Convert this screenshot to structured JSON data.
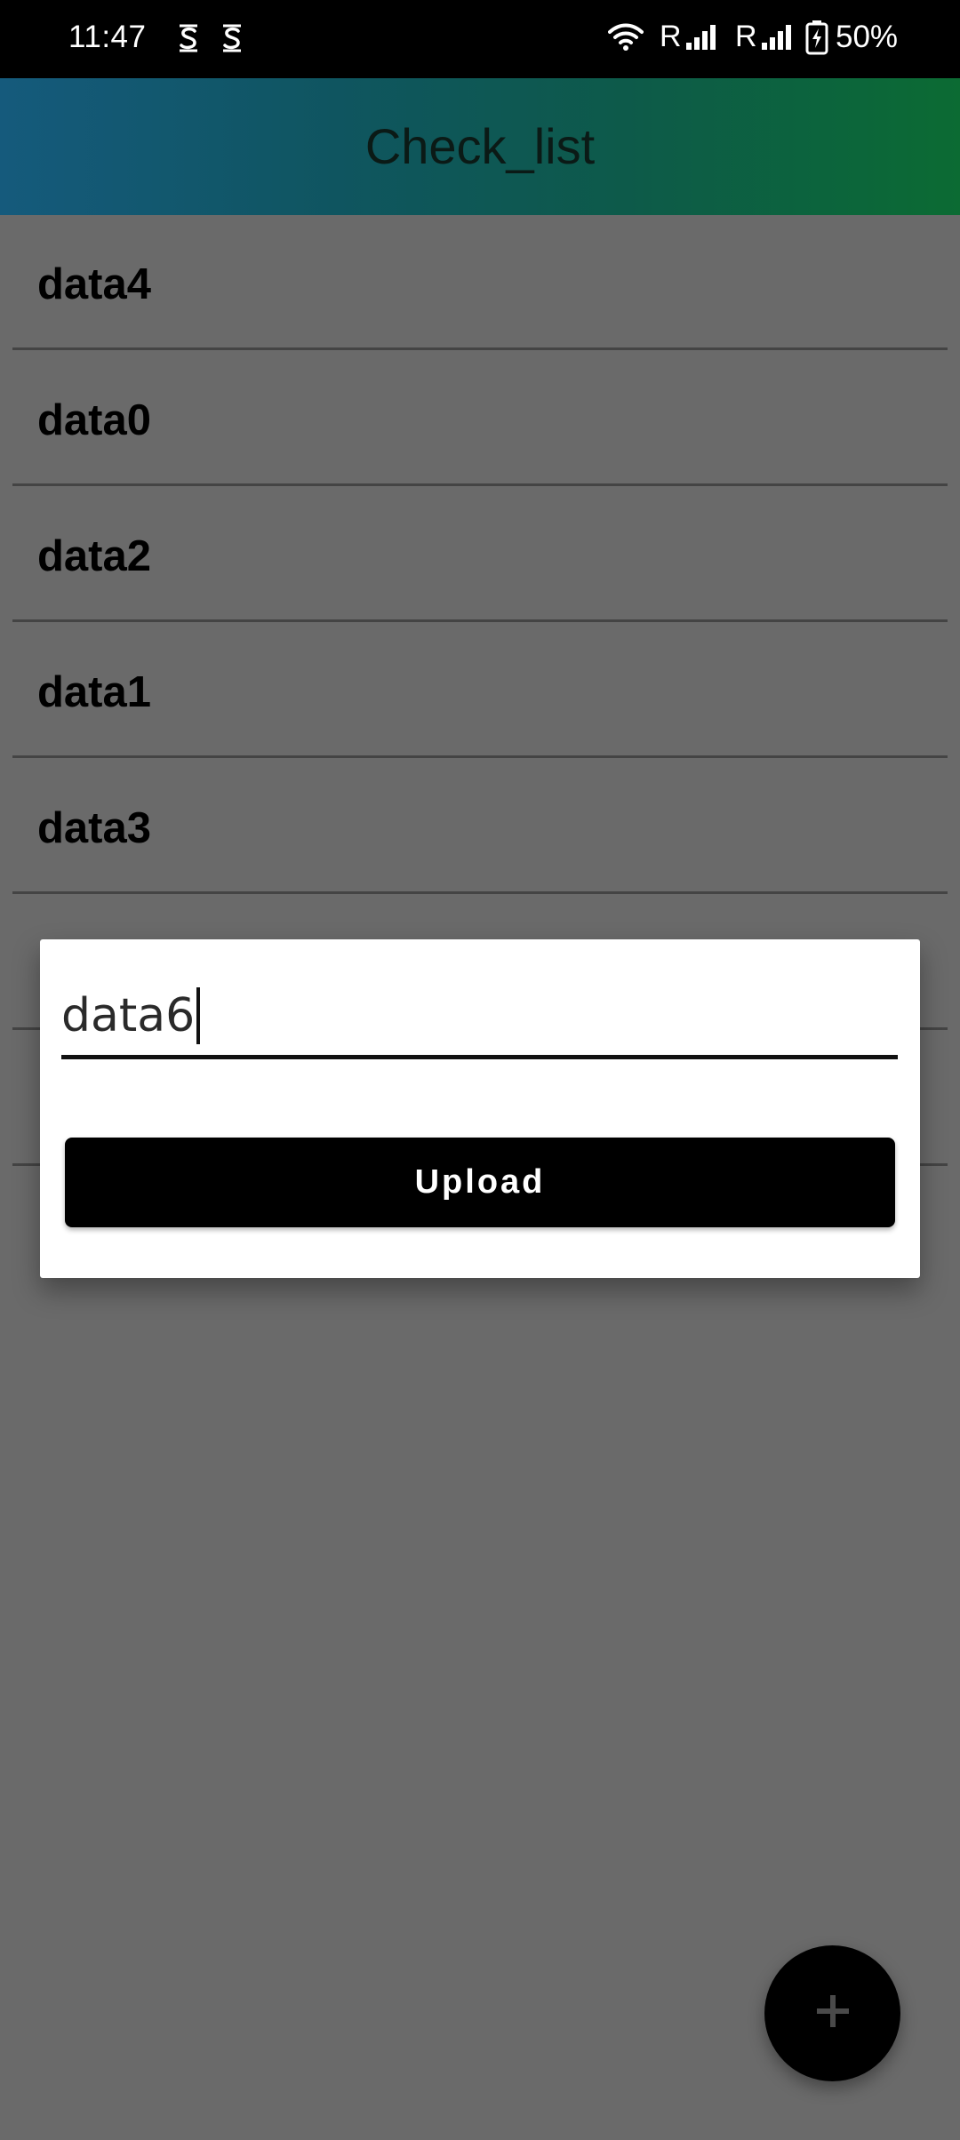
{
  "status_bar": {
    "time": "11:47",
    "network_roaming_1": "R",
    "network_roaming_2": "R",
    "battery": "50%",
    "icons": [
      "app-s-icon",
      "app-s-icon",
      "wifi-icon",
      "signal-icon",
      "signal-icon",
      "battery-charging-icon"
    ]
  },
  "app_bar": {
    "title": "Check_list"
  },
  "list": {
    "items": [
      {
        "label": "data4"
      },
      {
        "label": "data0"
      },
      {
        "label": "data2"
      },
      {
        "label": "data1"
      },
      {
        "label": "data3"
      },
      {
        "label": ""
      },
      {
        "label": ""
      }
    ]
  },
  "dialog": {
    "input_value": "data6",
    "upload_label": "Upload"
  },
  "fab": {
    "icon": "plus-icon"
  },
  "colors": {
    "scrim_background": "#6a6a6a",
    "app_bar_gradient_start": "#155a7c",
    "app_bar_gradient_end": "#0c6b33",
    "button": "#000000"
  }
}
